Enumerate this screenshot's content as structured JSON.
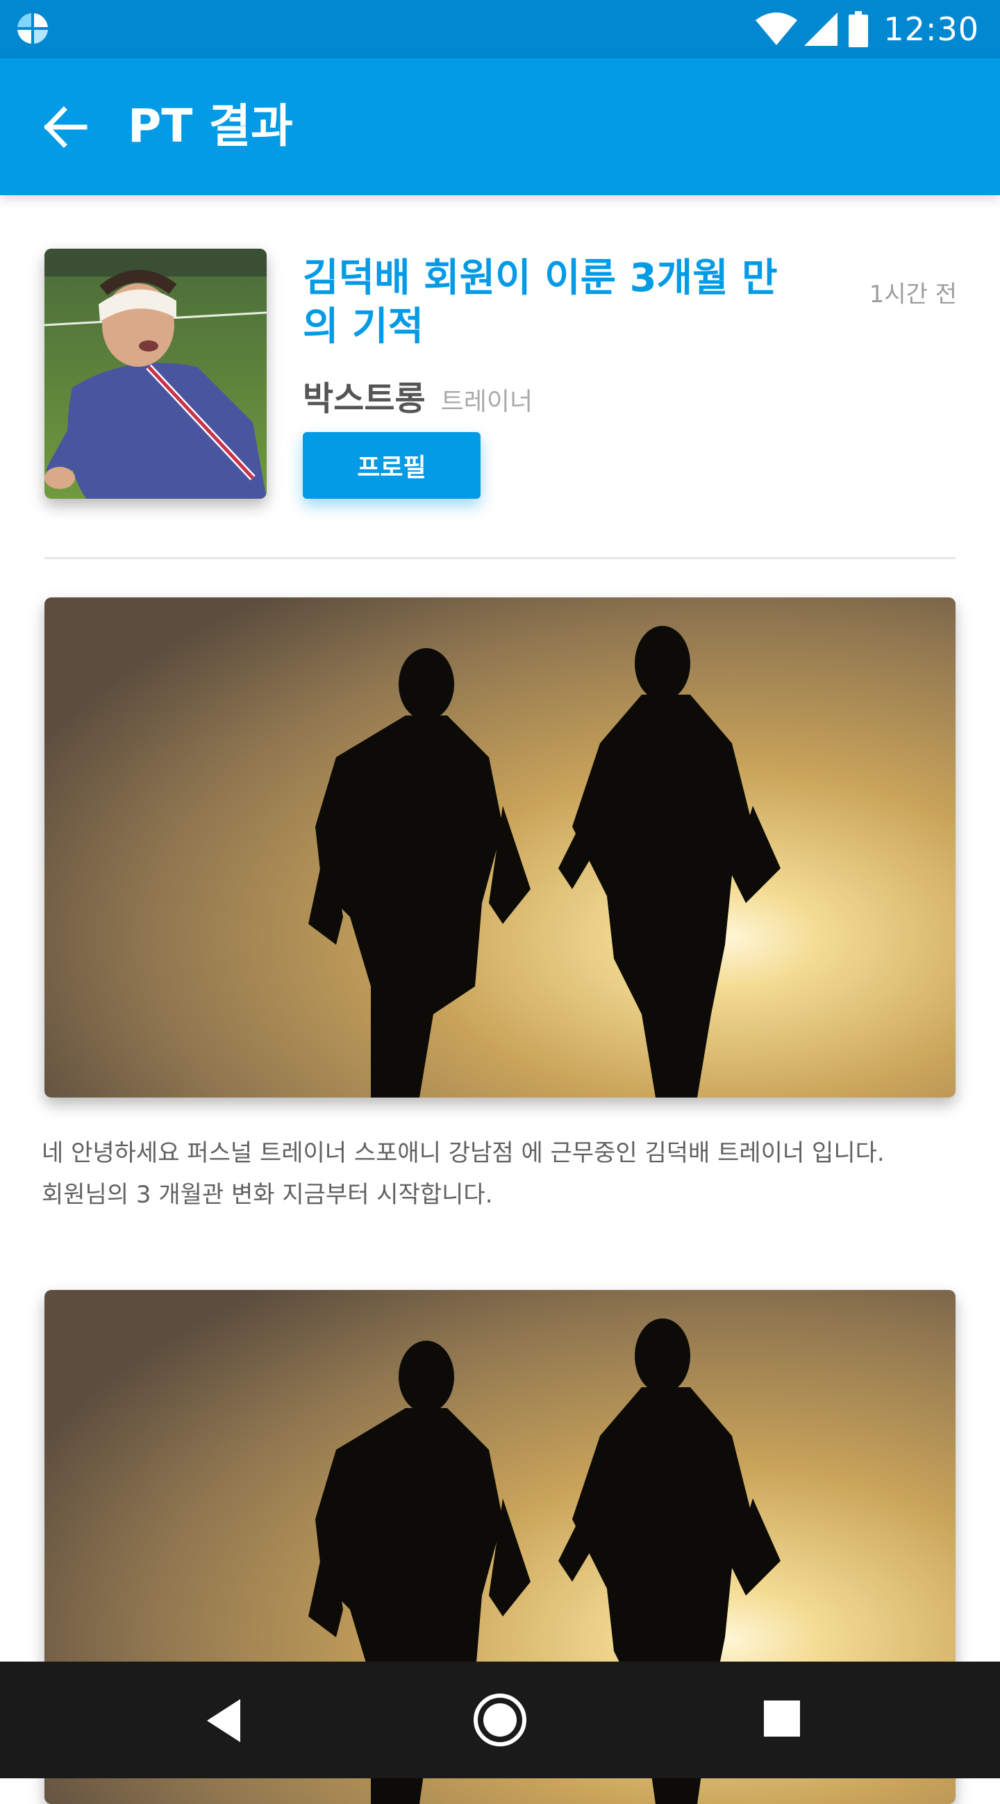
{
  "status_bar": {
    "time": "12:30",
    "icons": [
      "app-icon",
      "wifi-icon",
      "signal-icon",
      "battery-icon"
    ]
  },
  "app_bar": {
    "title": "PT 결과",
    "back_icon": "arrow-back-icon"
  },
  "post": {
    "title": "김덕배 회원이 이룬 3개월 만의 기적",
    "time_ago": "1시간 전",
    "trainer_name": "박스트롱",
    "trainer_role": "트레이너",
    "profile_button": "프로필",
    "body_line1": "네 안녕하세요 퍼스널 트레이너 스포애니 강남점 에 근무중인 김덕배 트레이너 입니다.",
    "body_line2": "회원님의 3 개월관 변화 지금부터 시작합니다."
  },
  "nav_bar": {
    "icons": [
      "nav-back-icon",
      "nav-home-icon",
      "nav-recents-icon"
    ]
  },
  "colors": {
    "status_bar": "#0288d1",
    "app_bar": "#039be5",
    "accent": "#039be5",
    "nav_bar": "#1a1a1a"
  }
}
